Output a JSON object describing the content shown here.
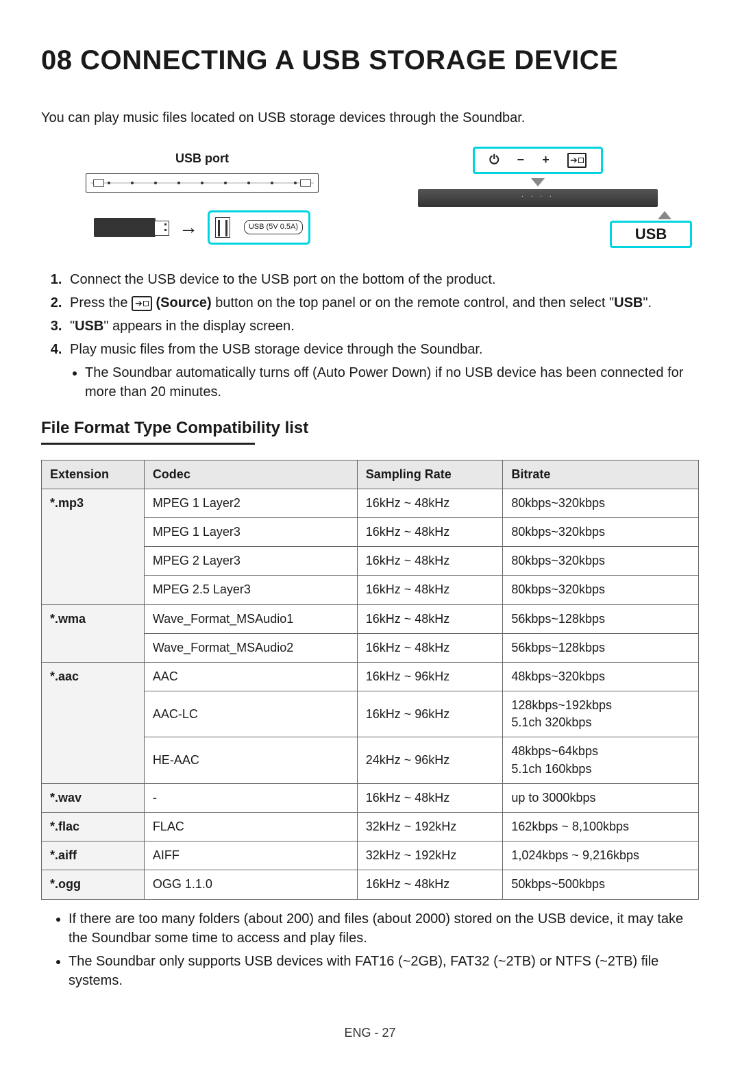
{
  "section": {
    "number": "08",
    "title": "CONNECTING A USB STORAGE DEVICE"
  },
  "intro": "You can play music files located on USB storage devices through the Soundbar.",
  "diagram": {
    "usb_port_label": "USB port",
    "port_text": "USB (5V 0.5A)",
    "display_text": "USB"
  },
  "steps": [
    "Connect the USB device to the USB port on the bottom of the product.",
    "Press the  (Source) button on the top panel or on the remote control, and then select \"USB\".",
    "\"USB\" appears in the display screen.",
    "Play music files from the USB storage device through the Soundbar."
  ],
  "step2_parts": {
    "pre": "Press the ",
    "source_label": "(Source)",
    "post": " button on the top panel or on the remote control, and then select \"",
    "usb": "USB",
    "end": "\"."
  },
  "step3_parts": {
    "pre": "\"",
    "usb": "USB",
    "post": "\" appears in the display screen."
  },
  "sub_note": "The Soundbar automatically turns off (Auto Power Down) if no USB device has been connected for more than 20 minutes.",
  "subheading": "File Format Type Compatibility list",
  "table": {
    "headers": [
      "Extension",
      "Codec",
      "Sampling Rate",
      "Bitrate"
    ],
    "groups": [
      {
        "ext": "*.mp3",
        "rows": [
          {
            "codec": "MPEG 1 Layer2",
            "rate": "16kHz ~ 48kHz",
            "bitrate": "80kbps~320kbps"
          },
          {
            "codec": "MPEG 1 Layer3",
            "rate": "16kHz ~ 48kHz",
            "bitrate": "80kbps~320kbps"
          },
          {
            "codec": "MPEG 2 Layer3",
            "rate": "16kHz ~ 48kHz",
            "bitrate": "80kbps~320kbps"
          },
          {
            "codec": "MPEG 2.5 Layer3",
            "rate": "16kHz ~ 48kHz",
            "bitrate": "80kbps~320kbps"
          }
        ]
      },
      {
        "ext": "*.wma",
        "rows": [
          {
            "codec": "Wave_Format_MSAudio1",
            "rate": "16kHz ~ 48kHz",
            "bitrate": "56kbps~128kbps"
          },
          {
            "codec": "Wave_Format_MSAudio2",
            "rate": "16kHz ~ 48kHz",
            "bitrate": "56kbps~128kbps"
          }
        ]
      },
      {
        "ext": "*.aac",
        "rows": [
          {
            "codec": "AAC",
            "rate": "16kHz ~ 96kHz",
            "bitrate": "48kbps~320kbps"
          },
          {
            "codec": "AAC-LC",
            "rate": "16kHz ~ 96kHz",
            "bitrate_multi": [
              "128kbps~192kbps",
              "5.1ch 320kbps"
            ]
          },
          {
            "codec": "HE-AAC",
            "rate": "24kHz ~ 96kHz",
            "bitrate_multi": [
              "48kbps~64kbps",
              "5.1ch 160kbps"
            ]
          }
        ]
      },
      {
        "ext": "*.wav",
        "rows": [
          {
            "codec": "-",
            "rate": "16kHz ~ 48kHz",
            "bitrate": "up to 3000kbps"
          }
        ]
      },
      {
        "ext": "*.flac",
        "rows": [
          {
            "codec": "FLAC",
            "rate": "32kHz ~ 192kHz",
            "bitrate": "162kbps ~ 8,100kbps"
          }
        ]
      },
      {
        "ext": "*.aiff",
        "rows": [
          {
            "codec": "AIFF",
            "rate": "32kHz ~ 192kHz",
            "bitrate": "1,024kbps ~ 9,216kbps"
          }
        ]
      },
      {
        "ext": "*.ogg",
        "rows": [
          {
            "codec": "OGG 1.1.0",
            "rate": "16kHz ~ 48kHz",
            "bitrate": "50kbps~500kbps"
          }
        ]
      }
    ]
  },
  "notes": [
    "If there are too many folders (about 200) and files (about 2000) stored on the USB device, it may take the Soundbar some time to access and play files.",
    "The Soundbar only supports USB devices with FAT16 (~2GB), FAT32 (~2TB) or NTFS (~2TB) file systems."
  ],
  "footer": "ENG - 27"
}
